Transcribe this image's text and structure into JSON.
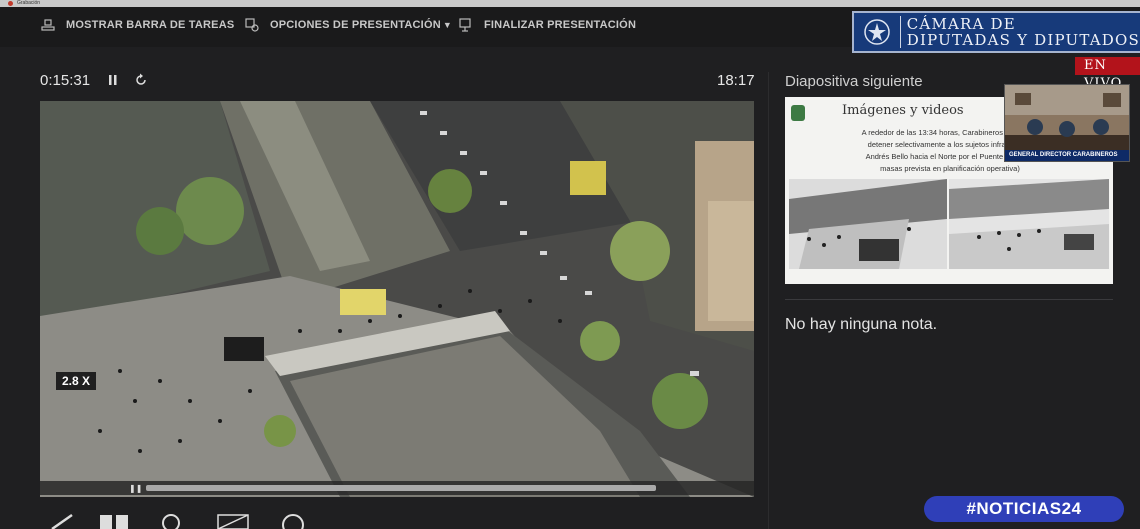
{
  "window": {
    "recording_label": "Grabación"
  },
  "toolbar": {
    "show_taskbar": "MOSTRAR BARRA DE TAREAS",
    "presentation_options": "OPCIONES DE PRESENTACIÓN",
    "end_presentation": "FINALIZAR PRESENTACIÓN",
    "icons": [
      "taskbar-icon",
      "presentation-options-icon",
      "end-presentation-icon"
    ]
  },
  "broadcast": {
    "chamber_name": "CÁMARA DE\nDIPUTADAS Y DIPUTADOS",
    "live_label": "EN VIVO",
    "pip_caption": "GENERAL DIRECTOR CARABINEROS",
    "channel_tag": "#NOTICIAS24"
  },
  "presenter": {
    "elapsed": "0:15:31",
    "clock": "18:17",
    "zoom": "2.8 X",
    "next_slide_label": "Diapositiva siguiente",
    "notes": "No hay ninguna nota."
  },
  "next_slide": {
    "title": "Imágenes y videos",
    "text": "A rededor de las 13:34 horas, Carabineros inicia inf...\ndetener selectivamente a los sujetos infractores...\nAndrés Bello hacia el Norte por el Puente Pío No...\nmasas prevista en planificación operativa)"
  },
  "colors": {
    "chamber_blue": "#173a7a",
    "live_red": "#b3131b",
    "news_blue": "#2f3fb8"
  }
}
